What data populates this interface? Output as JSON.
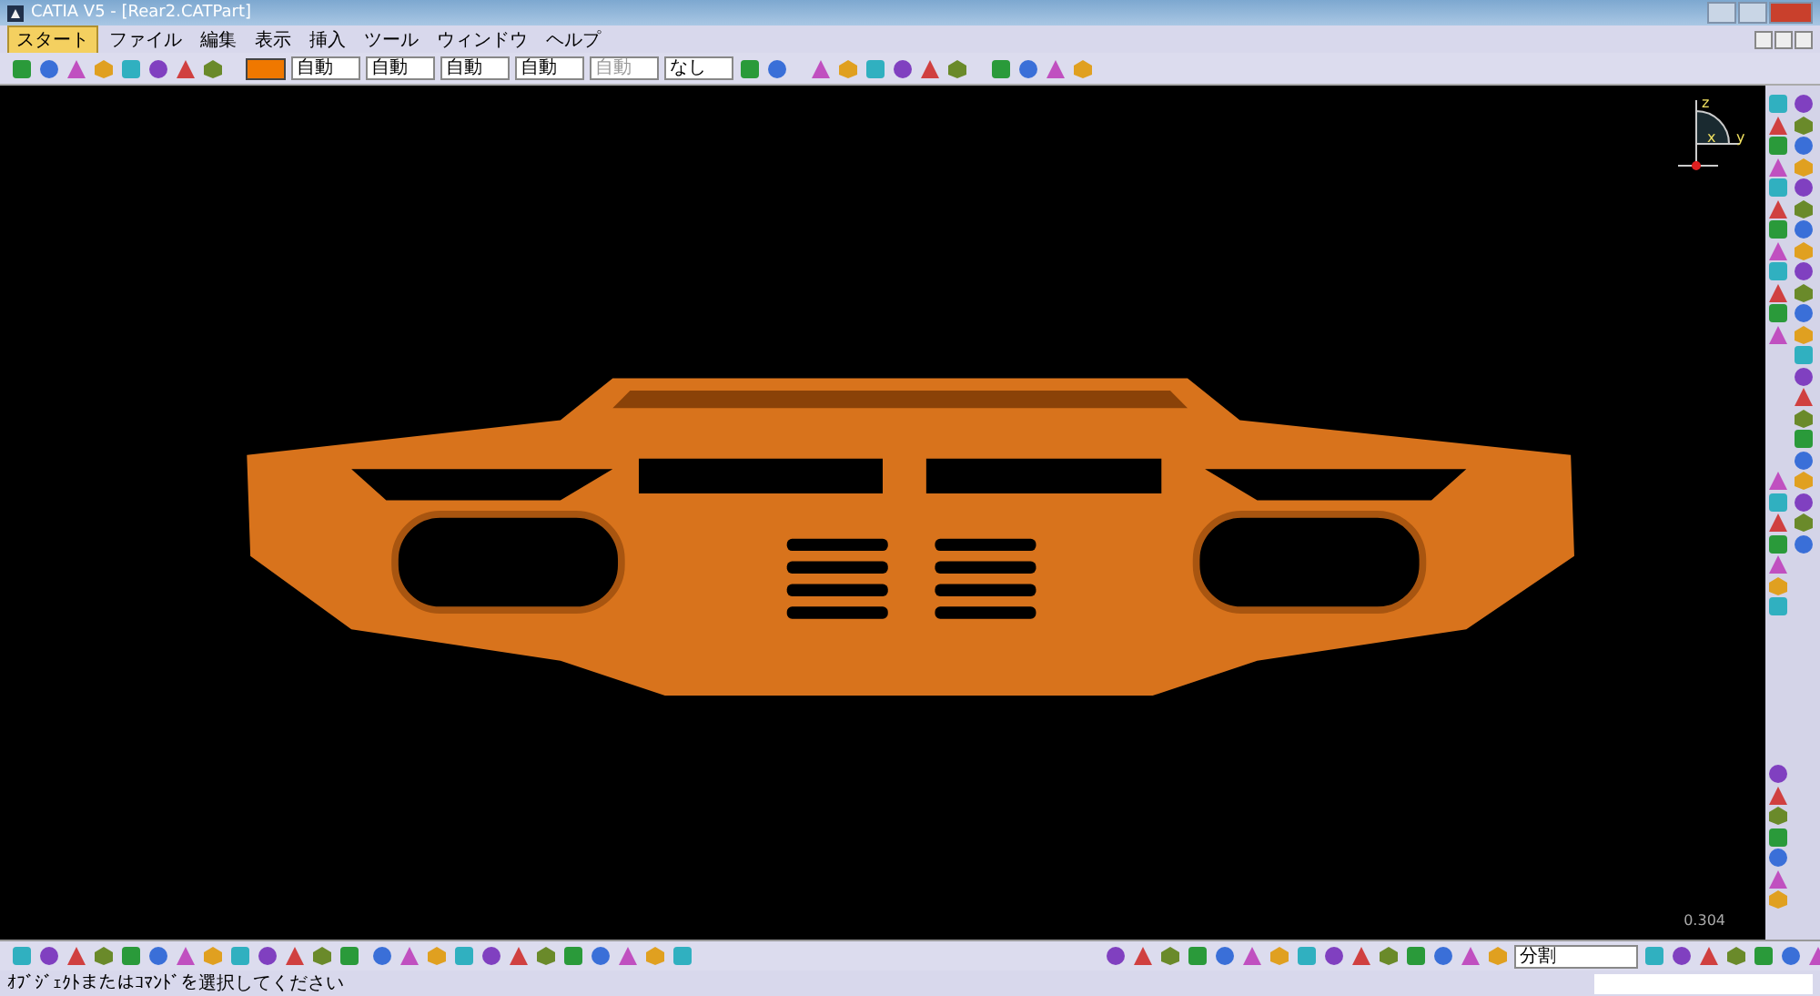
{
  "window": {
    "title": "CATIA V5 - [Rear2.CATPart]"
  },
  "menu": [
    {
      "label": "スタート",
      "selected": true
    },
    {
      "label": "ファイル",
      "selected": false
    },
    {
      "label": "編集",
      "selected": false
    },
    {
      "label": "表示",
      "selected": false
    },
    {
      "label": "挿入",
      "selected": false
    },
    {
      "label": "ツール",
      "selected": false
    },
    {
      "label": "ウィンドウ",
      "selected": false
    },
    {
      "label": "ヘルプ",
      "selected": false
    }
  ],
  "graphic_properties": {
    "color": "#f07800",
    "fields": [
      {
        "value": "自動",
        "disabled": false
      },
      {
        "value": "自動",
        "disabled": false
      },
      {
        "value": "自動",
        "disabled": false
      },
      {
        "value": "自動",
        "disabled": false
      },
      {
        "value": "自動",
        "disabled": true
      },
      {
        "value": "なし",
        "disabled": false
      }
    ]
  },
  "viewport": {
    "compass_axes": [
      "z",
      "x",
      "y"
    ],
    "scale_reading": "0.304"
  },
  "bottom_toolbar": {
    "dropdown": "分割"
  },
  "status_bar": {
    "message": "ｵﾌﾞｼﾞｪｸﾄまたはｺﾏﾝﾄﾞを選択してください"
  }
}
